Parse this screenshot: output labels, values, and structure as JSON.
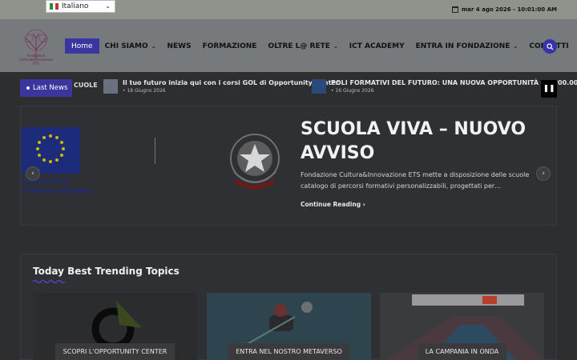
{
  "topbar": {
    "language": "Italiano",
    "datetime": "mar 4 ago 2026 - 10:01:00 AM"
  },
  "logo": {
    "text": "Fondazione Cultura&Innovazione ETS"
  },
  "nav": {
    "items": [
      {
        "label": "Home",
        "active": true,
        "dropdown": false
      },
      {
        "label": "CHI SIAMO",
        "dropdown": true
      },
      {
        "label": "NEWS",
        "dropdown": false
      },
      {
        "label": "FORMAZIONE",
        "dropdown": false
      },
      {
        "label": "OLTRE L@ RETE",
        "dropdown": true
      },
      {
        "label": "ICT ACADEMY",
        "dropdown": false
      },
      {
        "label": "ENTRA IN FONDAZIONE",
        "dropdown": true
      },
      {
        "label": "CONTATTI",
        "dropdown": false
      }
    ]
  },
  "ticker": {
    "label": "Last News",
    "prev_fragment": "CUOLE",
    "items": [
      {
        "title": "Il tuo futuro inizia qui con i corsi GOL di Opportunity Center.",
        "date": "18 Giugno 2026"
      },
      {
        "title": "POLI FORMATIVI DEL FUTURO: UNA NUOVA OPPORTUNITÀ DA 700.00",
        "date": "16 Giugno 2026"
      }
    ],
    "pause_symbol": "❚❚"
  },
  "slider": {
    "image_caption_line1": "Cofinanziato",
    "image_caption_line2": "l'Unione europea",
    "title": "SCUOLA VIVA – NUOVO AVVISO",
    "description": "Fondazione Cultura&Innovazione ETS mette a disposizione delle scuole catalogo di percorsi formativi personalizzabili, progettati per…",
    "read_more": "Continue Reading",
    "prev_symbol": "‹",
    "next_symbol": "›"
  },
  "trending": {
    "title": "Today Best Trending Topics",
    "cards": [
      {
        "label": "SCOPRI L'OPPORTUNITY CENTER"
      },
      {
        "label": "ENTRA NEL NOSTRO METAVERSO"
      },
      {
        "label": "LA CAMPANIA IN ONDA"
      }
    ]
  },
  "colors": {
    "accent": "#3a369e",
    "overlay": "#2d2e30"
  }
}
